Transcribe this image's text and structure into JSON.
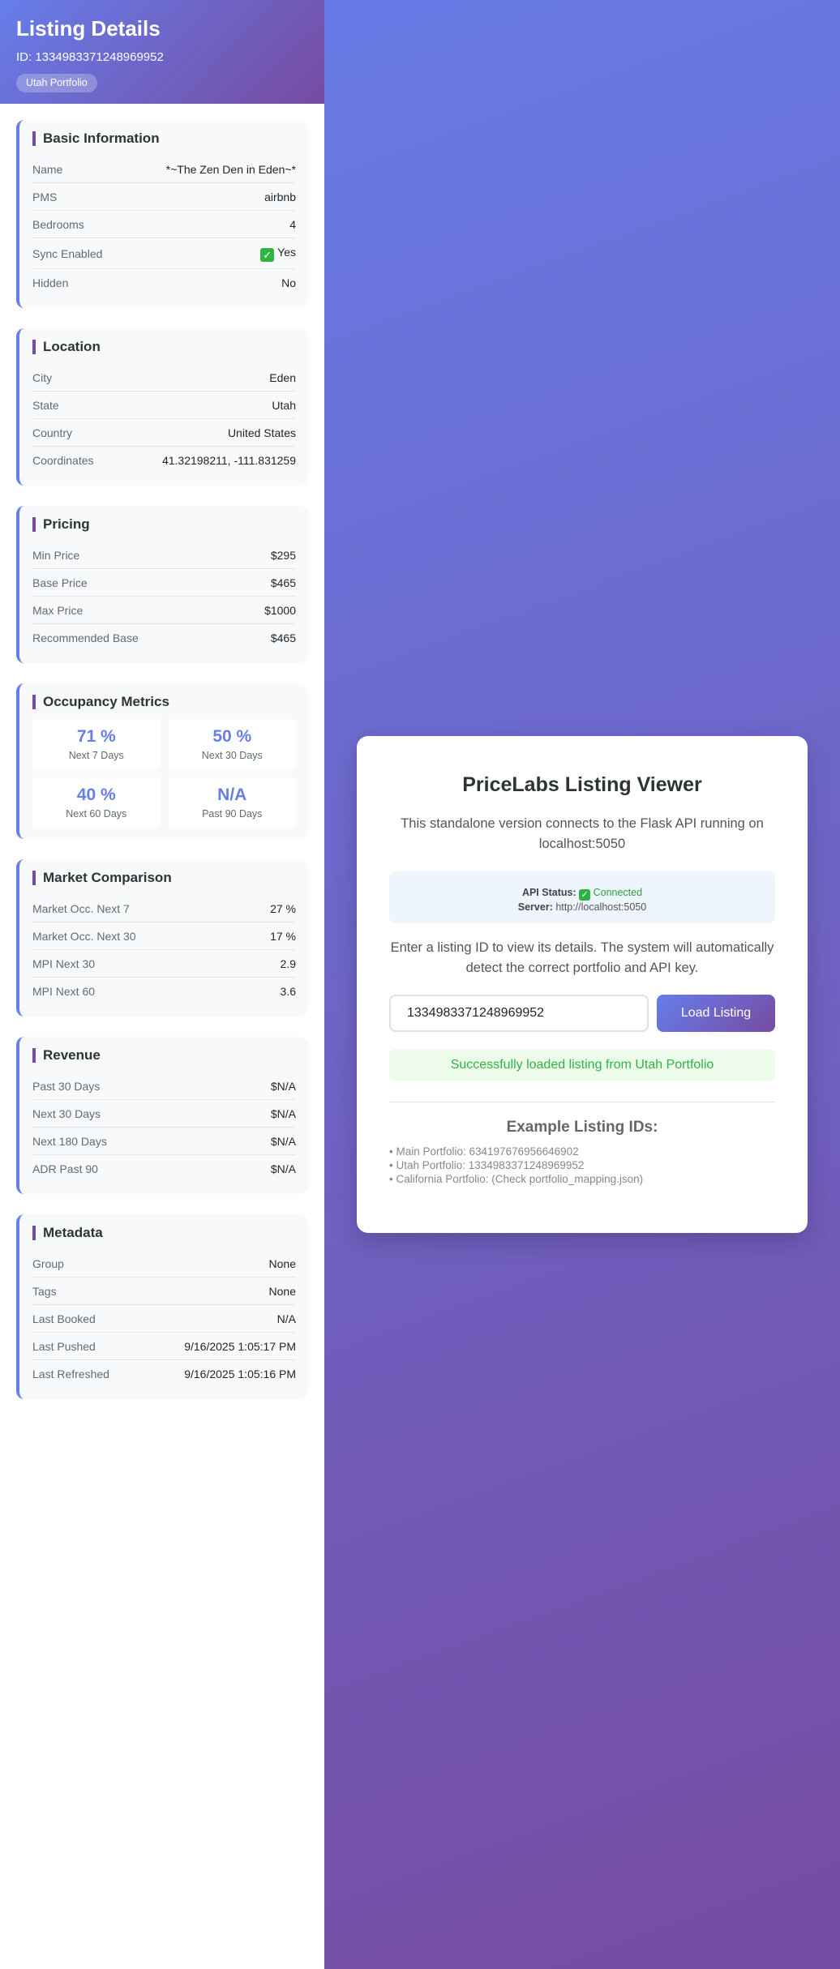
{
  "sidebar": {
    "title": "Listing Details",
    "id_line": "ID: 1334983371248969952",
    "portfolio_badge": "Utah Portfolio",
    "basic": {
      "title": "Basic Information",
      "name_label": "Name",
      "name_value": "*~The Zen Den in Eden~*",
      "pms_label": "PMS",
      "pms_value": "airbnb",
      "bedrooms_label": "Bedrooms",
      "bedrooms_value": "4",
      "sync_label": "Sync Enabled",
      "sync_icon": "✓",
      "sync_value": "Yes",
      "hidden_label": "Hidden",
      "hidden_value": "No"
    },
    "location": {
      "title": "Location",
      "city_label": "City",
      "city_value": "Eden",
      "state_label": "State",
      "state_value": "Utah",
      "country_label": "Country",
      "country_value": "United States",
      "coords_label": "Coordinates",
      "coords_value": "41.32198211, -111.831259"
    },
    "pricing": {
      "title": "Pricing",
      "min_label": "Min Price",
      "min_value": "$295",
      "base_label": "Base Price",
      "base_value": "$465",
      "max_label": "Max Price",
      "max_value": "$1000",
      "rec_label": "Recommended Base",
      "rec_value": "$465"
    },
    "occupancy": {
      "title": "Occupancy Metrics",
      "m7_value": "71 %",
      "m7_label": "Next 7 Days",
      "m30_value": "50 %",
      "m30_label": "Next 30 Days",
      "m60_value": "40 %",
      "m60_label": "Next 60 Days",
      "p90_value": "N/A",
      "p90_label": "Past 90 Days"
    },
    "market": {
      "title": "Market Comparison",
      "occ7_label": "Market Occ. Next 7",
      "occ7_value": "27 %",
      "occ30_label": "Market Occ. Next 30",
      "occ30_value": "17 %",
      "mpi30_label": "MPI Next 30",
      "mpi30_value": "2.9",
      "mpi60_label": "MPI Next 60",
      "mpi60_value": "3.6"
    },
    "revenue": {
      "title": "Revenue",
      "p30_label": "Past 30 Days",
      "p30_value": "$N/A",
      "n30_label": "Next 30 Days",
      "n30_value": "$N/A",
      "n180_label": "Next 180 Days",
      "n180_value": "$N/A",
      "adr_label": "ADR Past 90",
      "adr_value": "$N/A"
    },
    "metadata": {
      "title": "Metadata",
      "group_label": "Group",
      "group_value": "None",
      "tags_label": "Tags",
      "tags_value": "None",
      "booked_label": "Last Booked",
      "booked_value": "N/A",
      "pushed_label": "Last Pushed",
      "pushed_value": "9/16/2025 1:05:17 PM",
      "refreshed_label": "Last Refreshed",
      "refreshed_value": "9/16/2025 1:05:16 PM"
    }
  },
  "main": {
    "title": "PriceLabs Listing Viewer",
    "description": "This standalone version connects to the Flask API running on localhost:5050",
    "api_status_label": "API Status:",
    "api_status_icon": "✓",
    "api_status_value": "Connected",
    "server_label": "Server:",
    "server_value": "http://localhost:5050",
    "instructions": "Enter a listing ID to view its details. The system will automatically detect the correct portfolio and API key.",
    "input_value": "1334983371248969952",
    "load_button": "Load Listing",
    "success_message": "Successfully loaded listing from Utah Portfolio",
    "examples_title": "Example Listing IDs:",
    "examples": [
      "• Main Portfolio: 634197676956646902",
      "• Utah Portfolio: 1334983371248969952",
      "• California Portfolio: (Check portfolio_mapping.json)"
    ]
  },
  "colors": {
    "accent": "#667eea",
    "accent_dark": "#764ba2",
    "success": "#2fb344"
  }
}
